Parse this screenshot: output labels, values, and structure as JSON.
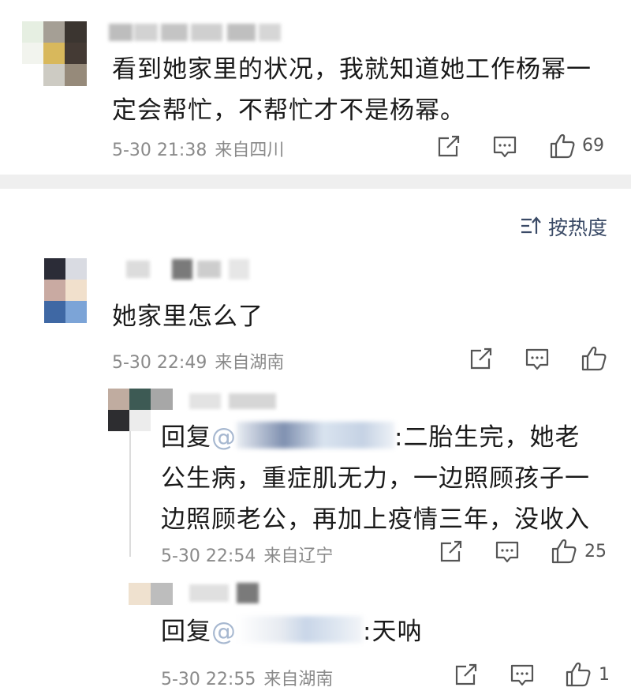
{
  "comments": [
    {
      "text": "看到她家里的状况，我就知道她工作杨幂一定会帮忙，不帮忙才不是杨幂。",
      "date": "5-30 21:38",
      "location": "来自四川",
      "likes": "69"
    },
    {
      "text": "她家里怎么了",
      "date": "5-30 22:49",
      "location": "来自湖南",
      "likes": "",
      "replies": [
        {
          "reply_prefix": "回复",
          "at": "@",
          "text": ":二胎生完，她老公生病，重症肌无力，一边照顾孩子一边照顾老公，再加上疫情三年，没收入",
          "date": "5-30 22:54",
          "location": "来自辽宁",
          "likes": "25"
        },
        {
          "reply_prefix": "回复",
          "at": "@",
          "text": ":天呐",
          "date": "5-30 22:55",
          "location": "来自湖南",
          "likes": "1"
        }
      ]
    }
  ],
  "sort": {
    "label": "按热度",
    "icon": "sort-icon"
  },
  "icons": {
    "share": "share-icon",
    "comment": "comment-icon",
    "like": "thumbs-up-icon"
  }
}
